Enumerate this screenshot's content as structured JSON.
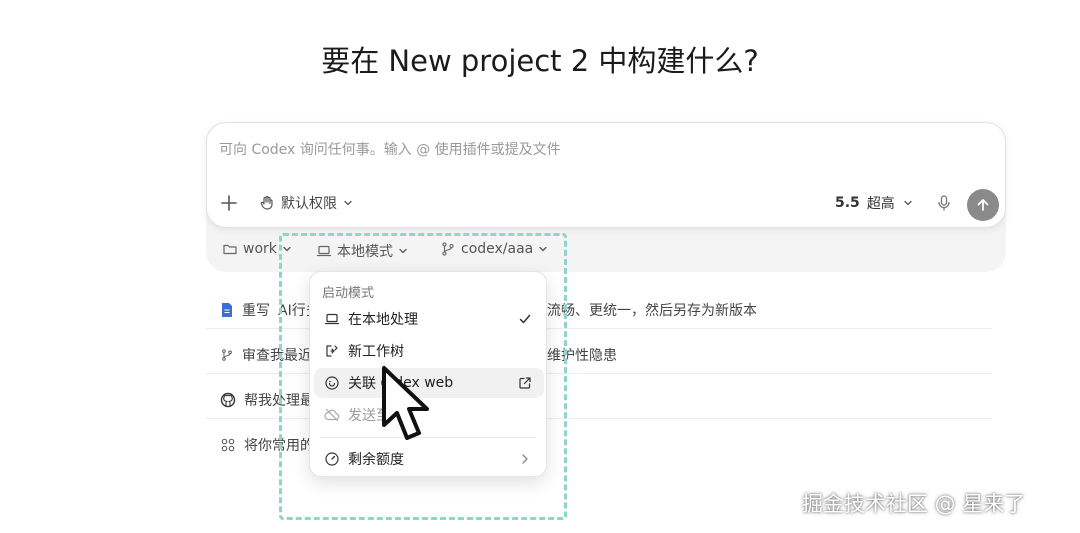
{
  "heading": "要在 New project 2 中构建什么?",
  "composer": {
    "placeholder": "可向 Codex 询问任何事。输入 @ 使用插件或提及文件",
    "permission_label": "默认权限",
    "model_version": "5.5",
    "model_speed": "超高"
  },
  "context_bar": {
    "folder": "work",
    "mode": "本地模式",
    "branch": "codex/aaa"
  },
  "suggestions": [
    {
      "icon": "document-icon",
      "text_left": "重写",
      "text_mid": "AI行多",
      "text_right": "流畅、更统一，然后另存为新版本"
    },
    {
      "icon": "branch-icon",
      "text_left": "审查我最近",
      "text_right": "维护性隐患"
    },
    {
      "icon": "github-icon",
      "text_left": "帮我处理最"
    },
    {
      "icon": "grid-icon",
      "text_left": "将你常用的"
    }
  ],
  "mode_menu": {
    "header": "启动模式",
    "items": [
      {
        "label": "在本地处理",
        "icon": "laptop-icon",
        "checked": true
      },
      {
        "label": "新工作树",
        "icon": "worktree-icon"
      },
      {
        "label": "关联 C",
        "label_tail": "dex web",
        "icon": "cloud-link-icon",
        "external": true
      },
      {
        "label": "发送至",
        "icon": "cloud-off-icon",
        "disabled": true
      }
    ],
    "footer_item": "剩余额度"
  },
  "watermark": "掘金技术社区 @ 星来了",
  "colors": {
    "accent_dash": "#8fd6c8",
    "send_button": "#8a8a8a"
  }
}
